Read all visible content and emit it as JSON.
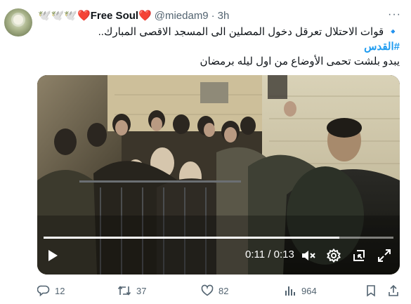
{
  "tweet": {
    "author_name": "🕊️🕊️🕊️❤️Free Soul❤️",
    "handle": "@miedam9",
    "separator": "·",
    "time": "3h",
    "more_label": "···",
    "lines": [
      "🔹 قوات الاحتلال تعرقل دخول المصلين الى المسجد الاقصى المبارك..",
      "#القدس",
      "يبدو بلشت تحمى الأوضاع من اول ليله برمضان"
    ]
  },
  "video": {
    "elapsed": "0:11",
    "duration": "0:13",
    "time_sep": " / ",
    "progress_fraction": 0.846,
    "controls": [
      "play-icon",
      "mute-icon",
      "settings-icon",
      "minimize-icon",
      "fullscreen-icon"
    ]
  },
  "actions": {
    "replies": "12",
    "reposts": "37",
    "likes": "82",
    "views": "964"
  },
  "colors": {
    "link": "#1d9bf0",
    "muted": "#536471",
    "text": "#0f1419"
  }
}
